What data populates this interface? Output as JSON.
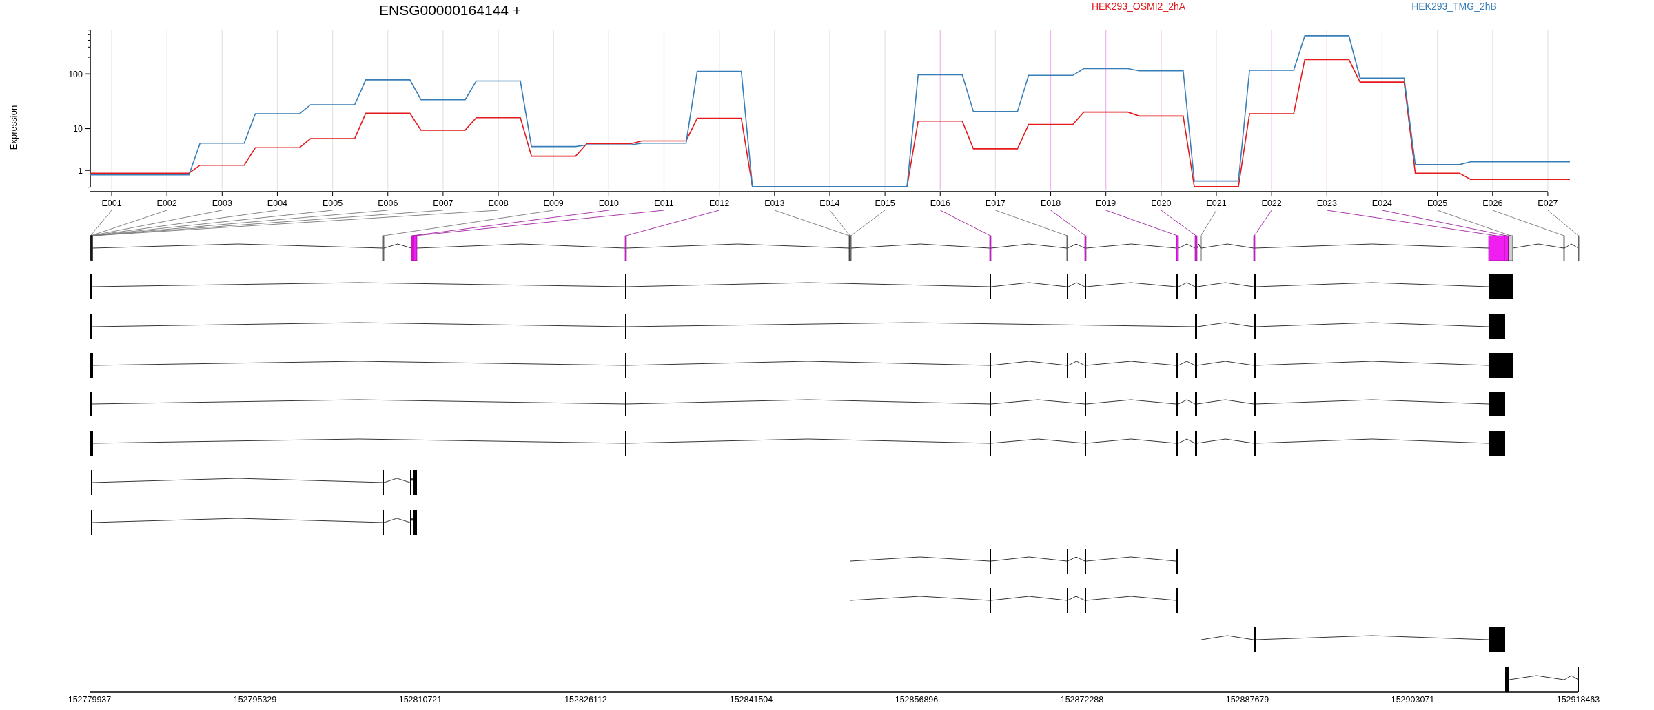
{
  "expression_plot": {
    "title": "ENSG00000164144 +",
    "y_axis_label": "Expression",
    "legend": [
      {
        "name": "HEK293_OSMI2_2hA",
        "color": "#e41a1c"
      },
      {
        "name": "HEK293_TMG_2hB",
        "color": "#377eb8"
      }
    ],
    "y_tick_labels": [
      "100",
      "10",
      "1"
    ],
    "exon_labels": [
      "E001",
      "E002",
      "E003",
      "E004",
      "E005",
      "E006",
      "E007",
      "E008",
      "E009",
      "E010",
      "E011",
      "E012",
      "E013",
      "E014",
      "E015",
      "E016",
      "E017",
      "E018",
      "E019",
      "E020",
      "E021",
      "E022",
      "E023",
      "E024",
      "E025",
      "E026",
      "E027"
    ]
  },
  "exons": [
    {
      "significant": false
    },
    {
      "significant": false
    },
    {
      "significant": false
    },
    {
      "significant": false
    },
    {
      "significant": false
    },
    {
      "significant": false
    },
    {
      "significant": false
    },
    {
      "significant": false
    },
    {
      "significant": false
    },
    {
      "significant": true
    },
    {
      "significant": true
    },
    {
      "significant": true
    },
    {
      "significant": false
    },
    {
      "significant": false
    },
    {
      "significant": false
    },
    {
      "significant": true
    },
    {
      "significant": false
    },
    {
      "significant": true
    },
    {
      "significant": true
    },
    {
      "significant": true
    },
    {
      "significant": false
    },
    {
      "significant": true
    },
    {
      "significant": true
    },
    {
      "significant": true
    },
    {
      "significant": false
    },
    {
      "significant": false
    },
    {
      "significant": false
    }
  ],
  "genome_axis": {
    "ticks": [
      "152779937",
      "152795329",
      "152810721",
      "152826112",
      "152841504",
      "152856896",
      "152872288",
      "152887679",
      "152903071",
      "152918463"
    ]
  }
}
